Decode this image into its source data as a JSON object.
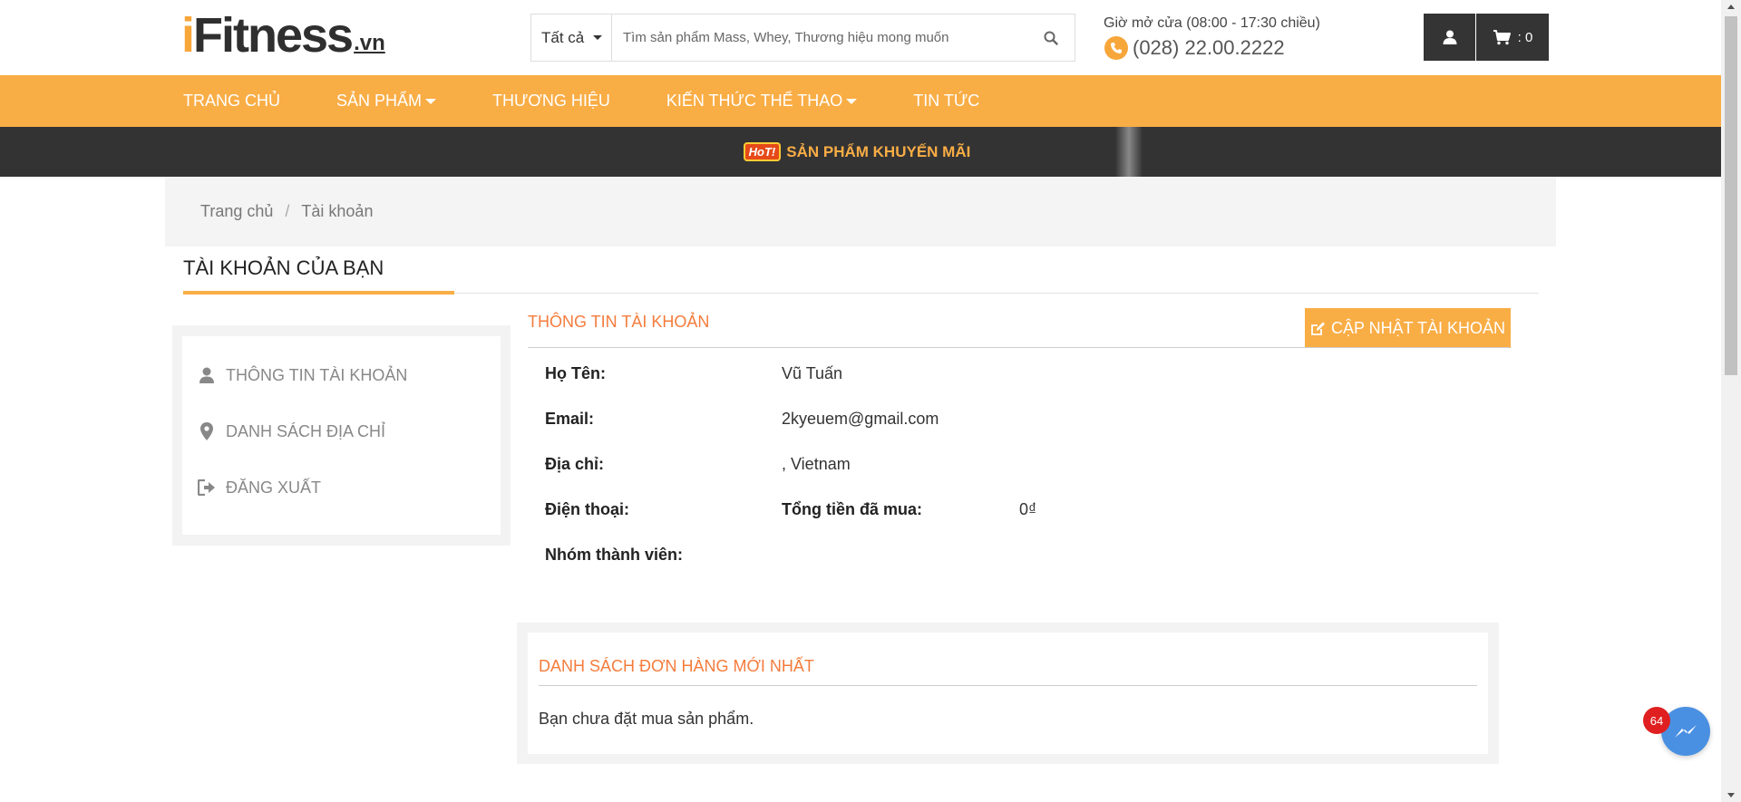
{
  "header": {
    "logo_main": "Fitness",
    "logo_i": "i",
    "logo_suffix": ".vn",
    "search": {
      "category": "Tất cả",
      "placeholder": "Tìm sản phẩm Mass, Whey, Thương hiệu mong muốn"
    },
    "hours": "Giờ mở cửa (08:00 - 17:30 chiều)",
    "phone": "(028) 22.00.2222",
    "cart_count": ": 0"
  },
  "nav": {
    "items": [
      {
        "label": "TRANG CHỦ"
      },
      {
        "label": "SẢN PHẨM"
      },
      {
        "label": "THƯƠNG HIỆU"
      },
      {
        "label": "KIẾN THỨC THỂ THAO"
      },
      {
        "label": "TIN TỨC"
      }
    ]
  },
  "promo": {
    "badge": "HoT!",
    "text": "SẢN PHẨM KHUYẾN MÃI"
  },
  "breadcrumb": {
    "home": "Trang chủ",
    "separator": "/",
    "current": "Tài khoản"
  },
  "page_title": "TÀI KHOẢN CỦA BẠN",
  "sidebar": {
    "items": [
      {
        "label": "THÔNG TIN TÀI KHOẢN",
        "icon": "user-icon"
      },
      {
        "label": "DANH SÁCH ĐỊA CHỈ",
        "icon": "map-marker-icon"
      },
      {
        "label": "ĐĂNG XUẤT",
        "icon": "sign-out-icon"
      }
    ]
  },
  "account": {
    "title": "THÔNG TIN TÀI KHOẢN",
    "update_label": "CẬP NHẬT TÀI KHOẢN",
    "name_label": "Họ Tên:",
    "name_value": "Vũ Tuấn",
    "email_label": "Email:",
    "email_value": "2kyeuem@gmail.com",
    "address_label": "Địa chỉ:",
    "address_value": ", Vietnam",
    "phone_label": "Điện thoại:",
    "total_label": "Tổng tiền đã mua:",
    "total_value": "0₫",
    "group_label": "Nhóm thành viên:"
  },
  "orders": {
    "title": "DANH SÁCH ĐƠN HÀNG MỚI NHẤT",
    "empty": "Bạn chưa đặt mua sản phẩm."
  },
  "messenger": {
    "badge": "64"
  },
  "colors": {
    "brand_orange": "#f9ad45",
    "accent_text": "#f47c3c",
    "dark_bar": "#333333"
  }
}
